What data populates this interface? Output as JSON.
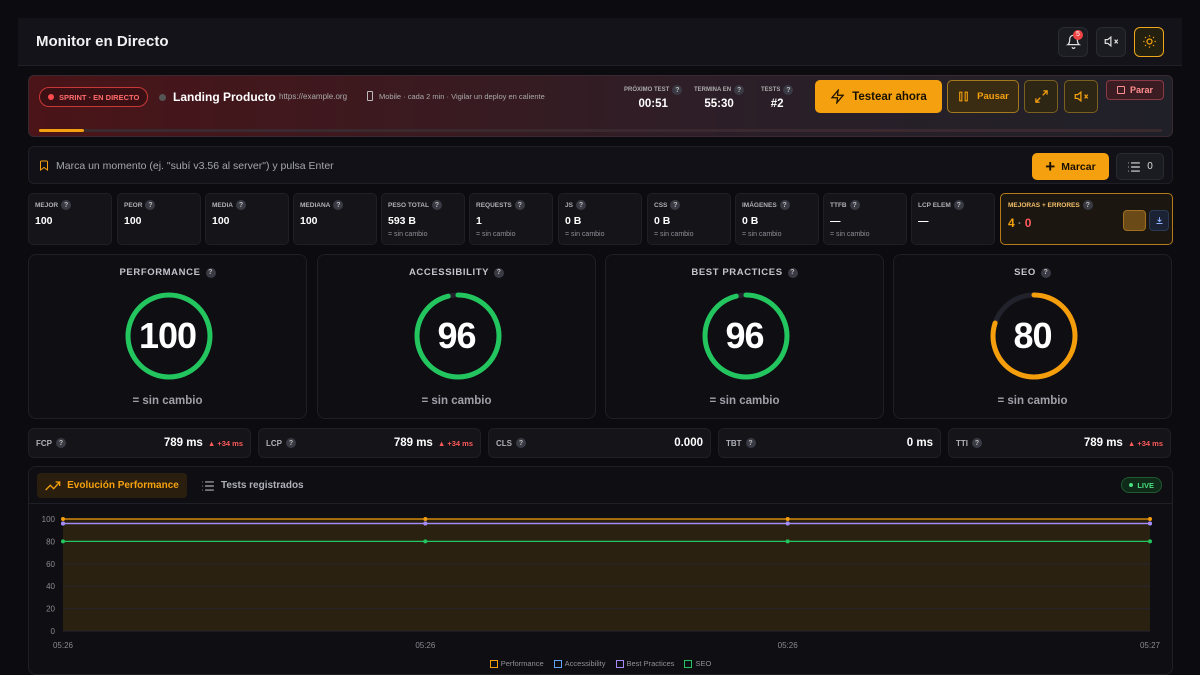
{
  "app": {
    "title": "Monitor en Directo",
    "notifications_count": "5"
  },
  "banner": {
    "sprint_label": "SPRINT · EN DIRECTO",
    "product_name": "Landing Producto",
    "url": "https://example.org",
    "description": "Mobile · cada 2 min · Vigilar un deploy en caliente",
    "next_test_label": "PRÓXIMO TEST",
    "next_test_value": "00:51",
    "ends_label": "TERMINA EN",
    "ends_value": "55:30",
    "tests_label": "TESTS",
    "tests_value": "#2",
    "test_now_label": "Testear ahora",
    "pause_label": "Pausar",
    "stop_label": "Parar",
    "progress": 0.04
  },
  "mark": {
    "placeholder": "Marca un momento (ej. \"subí v3.56 al server\") y pulsa Enter",
    "button_label": "Marcar",
    "list_count": "0"
  },
  "metrics": [
    {
      "label": "MEJOR",
      "value": "100",
      "sub": ""
    },
    {
      "label": "PEOR",
      "value": "100",
      "sub": ""
    },
    {
      "label": "MEDIA",
      "value": "100",
      "sub": ""
    },
    {
      "label": "MEDIANA",
      "value": "100",
      "sub": ""
    },
    {
      "label": "PESO TOTAL",
      "value": "593 B",
      "sub": "= sin cambio"
    },
    {
      "label": "REQUESTS",
      "value": "1",
      "sub": "= sin cambio"
    },
    {
      "label": "JS",
      "value": "0 B",
      "sub": "= sin cambio"
    },
    {
      "label": "CSS",
      "value": "0 B",
      "sub": "= sin cambio"
    },
    {
      "label": "IMÁGENES",
      "value": "0 B",
      "sub": "= sin cambio"
    },
    {
      "label": "TTFB",
      "value": "—",
      "sub": "= sin cambio"
    },
    {
      "label": "LCP ELEM",
      "value": "—",
      "sub": ""
    }
  ],
  "mejoras": {
    "label": "MEJORAS + ERRORES",
    "mejoras": "4",
    "separator": "·",
    "errores": "0"
  },
  "scores": [
    {
      "title": "PERFORMANCE",
      "value": "100",
      "fraction": 1.0,
      "color": "#22c55e",
      "sub": "= sin cambio"
    },
    {
      "title": "ACCESSIBILITY",
      "value": "96",
      "fraction": 0.96,
      "color": "#22c55e",
      "sub": "= sin cambio"
    },
    {
      "title": "BEST PRACTICES",
      "value": "96",
      "fraction": 0.96,
      "color": "#22c55e",
      "sub": "= sin cambio"
    },
    {
      "title": "SEO",
      "value": "80",
      "fraction": 0.8,
      "color": "#f59e0b",
      "sub": "= sin cambio"
    }
  ],
  "vitals": [
    {
      "label": "FCP",
      "value": "789 ms",
      "delta": "▲ +34 ms"
    },
    {
      "label": "LCP",
      "value": "789 ms",
      "delta": "▲ +34 ms"
    },
    {
      "label": "CLS",
      "value": "0.000",
      "delta": ""
    },
    {
      "label": "TBT",
      "value": "0 ms",
      "delta": ""
    },
    {
      "label": "TTI",
      "value": "789 ms",
      "delta": "▲ +34 ms"
    }
  ],
  "chart_tabs": {
    "active": "Evolución Performance",
    "other": "Tests registrados",
    "live": "LIVE"
  },
  "chart_data": {
    "type": "line",
    "x": [
      "05:26",
      "05:26",
      "05:26",
      "05:27"
    ],
    "yticks": [
      0,
      20,
      40,
      60,
      80,
      100
    ],
    "ylim": [
      0,
      100
    ],
    "series": [
      {
        "name": "Performance",
        "color": "#f59e0b",
        "values": [
          100,
          100,
          100,
          100
        ]
      },
      {
        "name": "Accessibility",
        "color": "#60a5fa",
        "values": [
          96,
          96,
          96,
          96
        ]
      },
      {
        "name": "Best Practices",
        "color": "#a78bfa",
        "values": [
          96,
          96,
          96,
          96
        ]
      },
      {
        "name": "SEO",
        "color": "#22c55e",
        "values": [
          80,
          80,
          80,
          80
        ]
      }
    ]
  }
}
